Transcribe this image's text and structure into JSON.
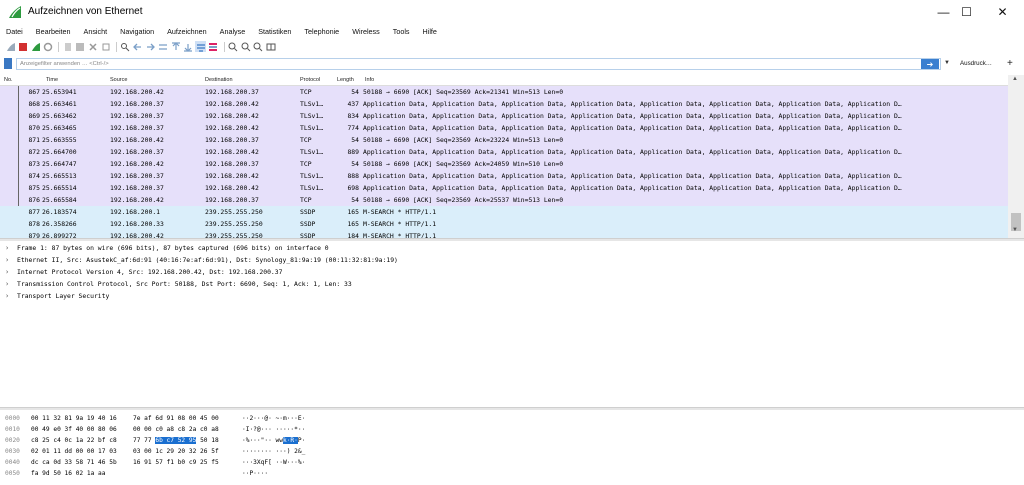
{
  "window": {
    "title": "Aufzeichnen von Ethernet",
    "min_glyph": "—",
    "max_glyph": "☐",
    "close_glyph": "✕"
  },
  "menu": [
    "Datei",
    "Bearbeiten",
    "Ansicht",
    "Navigation",
    "Aufzeichnen",
    "Analyse",
    "Statistiken",
    "Telephonie",
    "Wireless",
    "Tools",
    "Hilfe"
  ],
  "filter": {
    "placeholder": "Anzeigefilter anwenden … <Ctrl-/>",
    "expression_label": "Ausdruck…",
    "plus": "+"
  },
  "packet_list": {
    "columns": [
      "No.",
      "Time",
      "Source",
      "Destination",
      "Protocol",
      "Length",
      "Info"
    ],
    "rows": [
      {
        "no": "867",
        "time": "25.653941",
        "src": "192.168.200.42",
        "dst": "192.168.200.37",
        "proto": "TCP",
        "len": "54",
        "info": "50188 → 6690 [ACK] Seq=23569 Ack=21341 Win=513 Len=0",
        "kind": "tcp"
      },
      {
        "no": "868",
        "time": "25.663461",
        "src": "192.168.200.37",
        "dst": "192.168.200.42",
        "proto": "TLSv1…",
        "len": "437",
        "info": "Application Data, Application Data, Application Data, Application Data, Application Data, Application Data, Application Data, Application D…",
        "kind": "tls"
      },
      {
        "no": "869",
        "time": "25.663462",
        "src": "192.168.200.37",
        "dst": "192.168.200.42",
        "proto": "TLSv1…",
        "len": "834",
        "info": "Application Data, Application Data, Application Data, Application Data, Application Data, Application Data, Application Data, Application D…",
        "kind": "tls"
      },
      {
        "no": "870",
        "time": "25.663465",
        "src": "192.168.200.37",
        "dst": "192.168.200.42",
        "proto": "TLSv1…",
        "len": "774",
        "info": "Application Data, Application Data, Application Data, Application Data, Application Data, Application Data, Application Data, Application D…",
        "kind": "tls"
      },
      {
        "no": "871",
        "time": "25.663555",
        "src": "192.168.200.42",
        "dst": "192.168.200.37",
        "proto": "TCP",
        "len": "54",
        "info": "50188 → 6690 [ACK] Seq=23569 Ack=23224 Win=513 Len=0",
        "kind": "tcp"
      },
      {
        "no": "872",
        "time": "25.664700",
        "src": "192.168.200.37",
        "dst": "192.168.200.42",
        "proto": "TLSv1…",
        "len": "889",
        "info": "Application Data, Application Data, Application Data, Application Data, Application Data, Application Data, Application Data, Application D…",
        "kind": "tls"
      },
      {
        "no": "873",
        "time": "25.664747",
        "src": "192.168.200.42",
        "dst": "192.168.200.37",
        "proto": "TCP",
        "len": "54",
        "info": "50188 → 6690 [ACK] Seq=23569 Ack=24059 Win=510 Len=0",
        "kind": "tcp"
      },
      {
        "no": "874",
        "time": "25.665513",
        "src": "192.168.200.37",
        "dst": "192.168.200.42",
        "proto": "TLSv1…",
        "len": "888",
        "info": "Application Data, Application Data, Application Data, Application Data, Application Data, Application Data, Application Data, Application D…",
        "kind": "tls"
      },
      {
        "no": "875",
        "time": "25.665514",
        "src": "192.168.200.37",
        "dst": "192.168.200.42",
        "proto": "TLSv1…",
        "len": "698",
        "info": "Application Data, Application Data, Application Data, Application Data, Application Data, Application Data, Application Data, Application D…",
        "kind": "tls"
      },
      {
        "no": "876",
        "time": "25.665584",
        "src": "192.168.200.42",
        "dst": "192.168.200.37",
        "proto": "TCP",
        "len": "54",
        "info": "50188 → 6690 [ACK] Seq=23569 Ack=25537 Win=513 Len=0",
        "kind": "tcp"
      },
      {
        "no": "877",
        "time": "26.183574",
        "src": "192.168.200.1",
        "dst": "239.255.255.250",
        "proto": "SSDP",
        "len": "165",
        "info": "M-SEARCH * HTTP/1.1",
        "kind": "ssdp"
      },
      {
        "no": "878",
        "time": "26.358266",
        "src": "192.168.200.33",
        "dst": "239.255.255.250",
        "proto": "SSDP",
        "len": "165",
        "info": "M-SEARCH * HTTP/1.1",
        "kind": "ssdp"
      },
      {
        "no": "879",
        "time": "26.899272",
        "src": "192.168.200.42",
        "dst": "239.255.255.250",
        "proto": "SSDP",
        "len": "184",
        "info": "M-SEARCH * HTTP/1.1",
        "kind": "ssdp"
      }
    ]
  },
  "details": [
    "Frame 1: 87 bytes on wire (696 bits), 87 bytes captured (696 bits) on interface 0",
    "Ethernet II, Src: AsustekC_af:6d:91 (40:16:7e:af:6d:91), Dst: Synology_81:9a:19 (00:11:32:81:9a:19)",
    "Internet Protocol Version 4, Src: 192.168.200.42, Dst: 192.168.200.37",
    "Transmission Control Protocol, Src Port: 50188, Dst Port: 6690, Seq: 1, Ack: 1, Len: 33",
    "Transport Layer Security"
  ],
  "bytes": [
    {
      "off": "0000",
      "h1": "00 11 32 81 9a 19 40 16",
      "h2": "7e af 6d 91 08 00 45 00",
      "asc": "··2···@· ~·m···E·"
    },
    {
      "off": "0010",
      "h1": "00 49 e0 3f 40 00 80 06",
      "h2": "00 00 c0 a8 c8 2a c0 a8",
      "asc": "·I·?@··· ·····*··"
    },
    {
      "off": "0020",
      "h1": "c8 25 c4 0c 1a 22 bf c8",
      "h2": "77 77 ",
      "h2sel": "6b c7 52 95",
      "h2post": " 50 18",
      "asc": "·%···\"·· ww",
      "ascsel": "k·R·",
      "ascpost": "P·"
    },
    {
      "off": "0030",
      "h1": "02 01 11 dd 00 00 17 03",
      "h2": "03 00 1c 29 20 32 26 5f",
      "asc": "········ ···) 2&_"
    },
    {
      "off": "0040",
      "h1": "dc ca 0d 33 58 71 46 5b",
      "h2": "16 91 57 f1 b0 c9 25 f5",
      "asc": "···3XqF[ ··W···%·"
    },
    {
      "off": "0050",
      "h1": "fa 9d 50 16 02 1a aa",
      "h2": "",
      "asc": "··P····"
    }
  ],
  "colors": {
    "tcp_row": "#e6e0fa",
    "ssdp_row": "#daeefa",
    "selection": "#1a6fd0",
    "logo": "#2d9a3f"
  }
}
